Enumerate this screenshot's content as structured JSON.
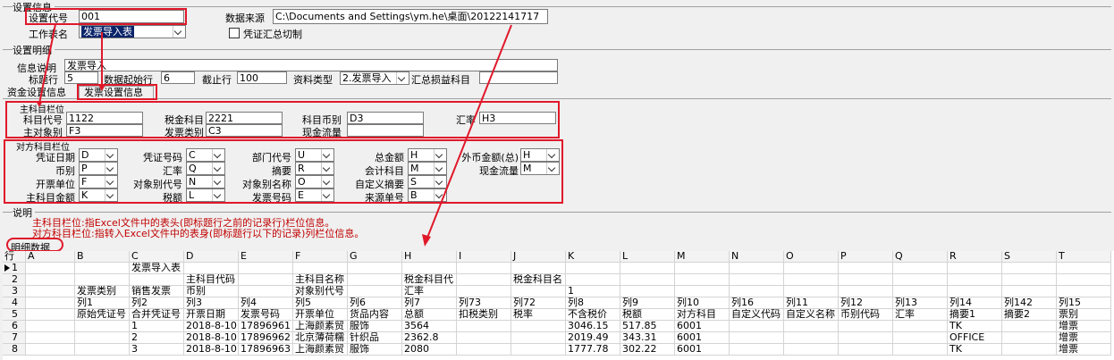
{
  "settings_info": {
    "section_title": "设置信息",
    "code_label": "设置代号",
    "code_value": "001",
    "source_label": "数据来源",
    "source_value": "C:\\Documents and Settings\\ym.he\\桌面\\20122141717",
    "sheet_label": "工作表名",
    "sheet_value": "发票导入表",
    "summary_label": "凭证汇总切制"
  },
  "detail_settings": {
    "section_title": "设置明细",
    "info_label": "信息说明",
    "info_value": "发票导入",
    "title_row_label": "标题行",
    "title_row_value": "5",
    "start_row_label": "数据起始行",
    "start_row_value": "6",
    "end_row_label": "截止行",
    "end_row_value": "100",
    "type_label": "资料类型",
    "type_value": "2.发票导入",
    "profit_label": "汇总损益科目"
  },
  "tabs": [
    "资金设置信息",
    "发票设置信息"
  ],
  "main_subject": {
    "title": "主科目栏位",
    "fields": [
      {
        "label": "科目代号",
        "value": "1122"
      },
      {
        "label": "税金科目",
        "value": "2221"
      },
      {
        "label": "科目币别",
        "value": "D3"
      },
      {
        "label": "汇率",
        "value": "H3"
      },
      {
        "label": "主对象别",
        "value": "F3"
      },
      {
        "label": "发票类别",
        "value": "C3"
      },
      {
        "label": "现金流量",
        "value": ""
      }
    ]
  },
  "contra_subject": {
    "title": "对方科目栏位",
    "fields": [
      {
        "label": "凭证日期",
        "value": "D"
      },
      {
        "label": "币别",
        "value": "P"
      },
      {
        "label": "开票单位",
        "value": "F"
      },
      {
        "label": "主科目金额",
        "value": "K"
      },
      {
        "label": "凭证号码",
        "value": "C"
      },
      {
        "label": "汇率",
        "value": "Q"
      },
      {
        "label": "对象别代号",
        "value": "N"
      },
      {
        "label": "税额",
        "value": "L"
      },
      {
        "label": "部门代号",
        "value": "U"
      },
      {
        "label": "摘要",
        "value": "R"
      },
      {
        "label": "对象别名称",
        "value": "O"
      },
      {
        "label": "发票号码",
        "value": "E"
      },
      {
        "label": "总金额",
        "value": "H"
      },
      {
        "label": "会计科目",
        "value": "M"
      },
      {
        "label": "自定义摘要",
        "value": "S"
      },
      {
        "label": "来源单号",
        "value": "B"
      },
      {
        "label": "外币金额(总)",
        "value": "H"
      },
      {
        "label": "现金流量",
        "value": "M"
      }
    ]
  },
  "notes": {
    "title": "说明",
    "line1": "主科目栏位:指Excel文件中的表头(即标题行之前的记录行)栏位信息。",
    "line2": "对方科目栏位:指转入Excel文件中的表身(即标题行以下的记录)列栏位信息。"
  },
  "detail_data": {
    "title": "明细数据",
    "corner": "行",
    "columns": [
      "A",
      "B",
      "C",
      "D",
      "E",
      "F",
      "G",
      "H",
      "I",
      "J",
      "K",
      "L",
      "M",
      "N",
      "O",
      "P",
      "Q",
      "R",
      "S",
      "T"
    ],
    "rows": [
      {
        "num": "1",
        "cells": [
          "",
          "",
          "发票导入表",
          "",
          "",
          "",
          "",
          "",
          "",
          "",
          "",
          "",
          "",
          "",
          "",
          "",
          "",
          "",
          "",
          ""
        ]
      },
      {
        "num": "2",
        "cells": [
          "",
          "",
          "",
          "主科目代码",
          "",
          "主科目名称",
          "",
          "税金科目代",
          "",
          "税金科目名",
          "",
          "",
          "",
          "",
          "",
          "",
          "",
          "",
          "",
          ""
        ]
      },
      {
        "num": "3",
        "cells": [
          "",
          "发票类别",
          "销售发票",
          "币别",
          "",
          "对象别代号",
          "",
          "汇率",
          "",
          "",
          "1",
          "",
          "",
          "",
          "",
          "",
          "",
          "",
          "",
          ""
        ]
      },
      {
        "num": "4",
        "cells": [
          "",
          "列1",
          "列2",
          "列3",
          "列4",
          "列5",
          "列6",
          "列7",
          "列73",
          "列72",
          "列8",
          "列9",
          "列10",
          "列16",
          "列11",
          "列12",
          "列13",
          "列14",
          "列142",
          "列15"
        ]
      },
      {
        "num": "5",
        "cells": [
          "",
          "原始凭证号",
          "合并凭证号",
          "开票日期",
          "发票号码",
          "开票单位",
          "货品内容",
          "总额",
          "扣税类别",
          "税率",
          "不含税价",
          "税额",
          "对方科目",
          "自定义代码",
          "自定义名称",
          "币别代码",
          "汇率",
          "摘要1",
          "摘要2",
          "票别"
        ]
      },
      {
        "num": "6",
        "cells": [
          "",
          "",
          "1",
          "2018-8-10",
          "17896961",
          "上海颜素贸",
          "服饰",
          "3564",
          "",
          "",
          "3046.15",
          "517.85",
          "6001",
          "",
          "",
          "",
          "",
          "TK",
          "",
          "增票"
        ]
      },
      {
        "num": "7",
        "cells": [
          "",
          "",
          "2",
          "2018-8-10",
          "17896962",
          "北京薄荷糯",
          "针织品",
          "2362.8",
          "",
          "",
          "2019.49",
          "343.31",
          "6001",
          "",
          "",
          "",
          "",
          "OFFICE",
          "",
          "增票"
        ]
      },
      {
        "num": "8",
        "cells": [
          "",
          "",
          "3",
          "2018-8-10",
          "17896963",
          "上海颜素贸",
          "服饰",
          "2080",
          "",
          "",
          "1777.78",
          "302.22",
          "6001",
          "",
          "",
          "",
          "",
          "TK",
          "",
          "增票"
        ]
      }
    ]
  }
}
